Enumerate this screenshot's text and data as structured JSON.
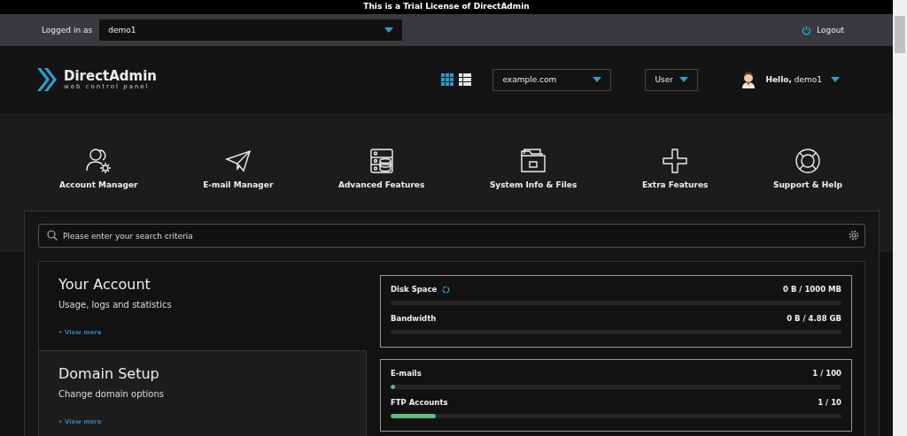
{
  "trial_banner": "This is a Trial License of DirectAdmin",
  "top_bar": {
    "logged_in_label": "Logged in as",
    "user_select": "demo1",
    "logout": "Logout"
  },
  "header": {
    "logo_title": "DirectAdmin",
    "logo_subtitle": "web control panel",
    "view_toggle": [
      {
        "kind": "grid",
        "selected": true
      },
      {
        "kind": "list",
        "selected": false
      }
    ],
    "domain_select": "example.com",
    "level_select": "User",
    "greeting_bold": "Hello,",
    "greeting_user": "demo1"
  },
  "nav": [
    {
      "kind": "account",
      "label": "Account Manager"
    },
    {
      "kind": "email",
      "label": "E-mail Manager"
    },
    {
      "kind": "advanced",
      "label": "Advanced Features"
    },
    {
      "kind": "files",
      "label": "System Info & Files"
    },
    {
      "kind": "extra",
      "label": "Extra Features"
    },
    {
      "kind": "support",
      "label": "Support & Help"
    }
  ],
  "search": {
    "placeholder": "Please enter your search criteria"
  },
  "sections": [
    {
      "title": "Your Account",
      "subtitle": "Usage, logs and statistics",
      "link": "• View more",
      "highlighted": false
    },
    {
      "title": "Domain Setup",
      "subtitle": "Change domain options",
      "link": "• View more",
      "highlighted": true
    }
  ],
  "usage_groups": [
    {
      "items": [
        {
          "name": "Disk Space",
          "refresh": true,
          "reading": "0 B / 1000 MB",
          "level": 0
        },
        {
          "name": "Bandwidth",
          "refresh": false,
          "reading": "0 B / 4.88 GB",
          "level": 0
        }
      ]
    },
    {
      "items": [
        {
          "name": "E-mails",
          "refresh": false,
          "reading": "1 / 100",
          "level": 0.01
        },
        {
          "name": "FTP Accounts",
          "refresh": false,
          "reading": "1 / 10",
          "level": 0.1
        }
      ]
    }
  ]
}
